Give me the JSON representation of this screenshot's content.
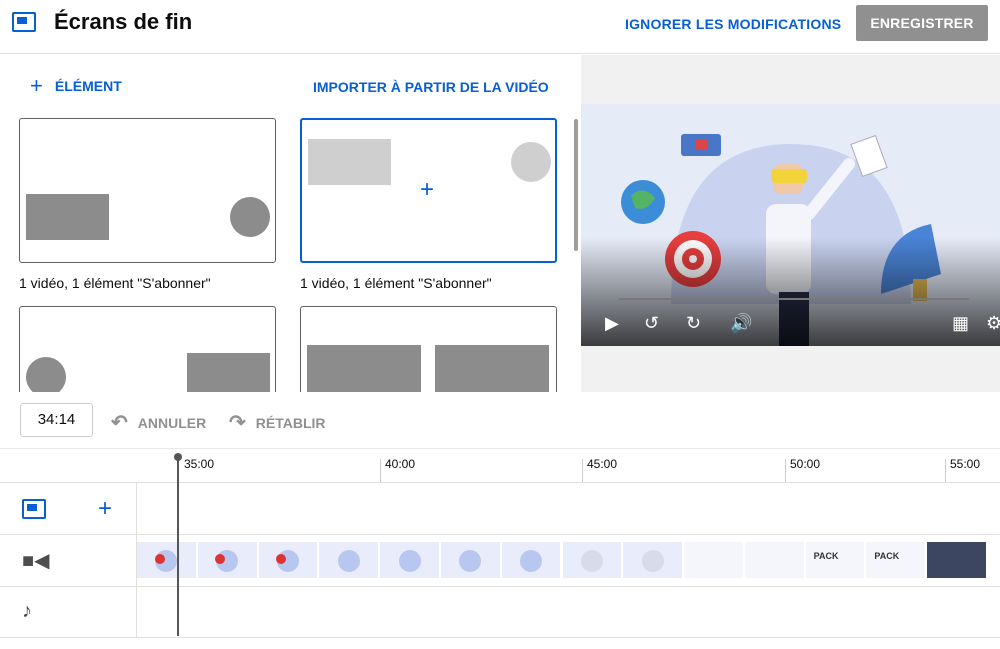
{
  "header": {
    "title": "Écrans de fin",
    "discard_label": "IGNORER LES MODIFICATIONS",
    "save_label": "ENREGISTRER"
  },
  "panel": {
    "add_element_label": "ÉLÉMENT",
    "import_label": "IMPORTER À PARTIR DE LA VIDÉO",
    "templates": [
      {
        "caption": "1 vidéo, 1 élément \"S'abonner\""
      },
      {
        "caption": "1 vidéo, 1 élément \"S'abonner\""
      }
    ]
  },
  "toolbar": {
    "current_time": "34:14",
    "undo_label": "ANNULER",
    "redo_label": "RÉTABLIR"
  },
  "timeline": {
    "ticks": [
      "35:00",
      "40:00",
      "45:00",
      "50:00",
      "55:00"
    ],
    "frames": [
      {
        "kind": "vr"
      },
      {
        "kind": "vr"
      },
      {
        "kind": "vr"
      },
      {
        "kind": "dome"
      },
      {
        "kind": "dome"
      },
      {
        "kind": "dome"
      },
      {
        "kind": "dome"
      },
      {
        "kind": "team"
      },
      {
        "kind": "team"
      },
      {
        "kind": "blank"
      },
      {
        "kind": "blank"
      },
      {
        "kind": "pack",
        "text": "PACK"
      },
      {
        "kind": "pack",
        "text": "PACK"
      },
      {
        "kind": "dark"
      }
    ]
  },
  "colors": {
    "accent": "#065fd4",
    "save_disabled": "#909090",
    "muted": "#909090"
  },
  "icons": {
    "app": "end-screen-icon",
    "undo": "undo-icon",
    "redo": "redo-icon",
    "end_screen_track": "end-screen-track-icon",
    "video_track": "videocam-icon",
    "audio_track": "music-note-icon"
  }
}
